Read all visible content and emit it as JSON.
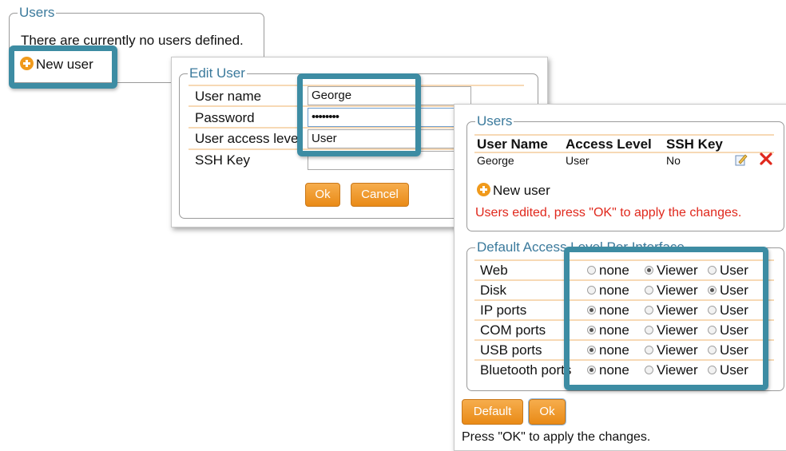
{
  "users_panel": {
    "legend": "Users",
    "empty_text": "There are currently no users defined.",
    "new_user": "New user"
  },
  "edit_user": {
    "legend": "Edit User",
    "fields": [
      {
        "label": "User name",
        "value": "George"
      },
      {
        "label": "Password",
        "value": "••••••••"
      },
      {
        "label": "User access level",
        "value": "User"
      },
      {
        "label": "SSH Key",
        "value": ""
      }
    ],
    "ok": "Ok",
    "cancel": "Cancel"
  },
  "users_panel2": {
    "legend": "Users",
    "headers": [
      "User Name",
      "Access Level",
      "SSH Key"
    ],
    "rows": [
      {
        "name": "George",
        "level": "User",
        "ssh": "No"
      }
    ],
    "new_user": "New user",
    "warning": "Users edited, press \"OK\" to apply the changes.",
    "warning_color": "#e0281c"
  },
  "access_panel": {
    "legend": "Default Access Level Per Interface",
    "options": [
      "none",
      "Viewer",
      "User"
    ],
    "rows": [
      {
        "label": "Web",
        "selected": "Viewer"
      },
      {
        "label": "Disk",
        "selected": "User"
      },
      {
        "label": "IP ports",
        "selected": "none"
      },
      {
        "label": "COM ports",
        "selected": "none"
      },
      {
        "label": "USB ports",
        "selected": "none"
      },
      {
        "label": "Bluetooth ports",
        "selected": "none"
      }
    ]
  },
  "footer": {
    "default": "Default",
    "ok": "Ok",
    "note": "Press \"OK\" to apply the changes."
  },
  "colors": {
    "accent_highlight": "#3d8ca3",
    "button_orange": "#f09a1c",
    "legend_blue": "#3b7a9c"
  }
}
